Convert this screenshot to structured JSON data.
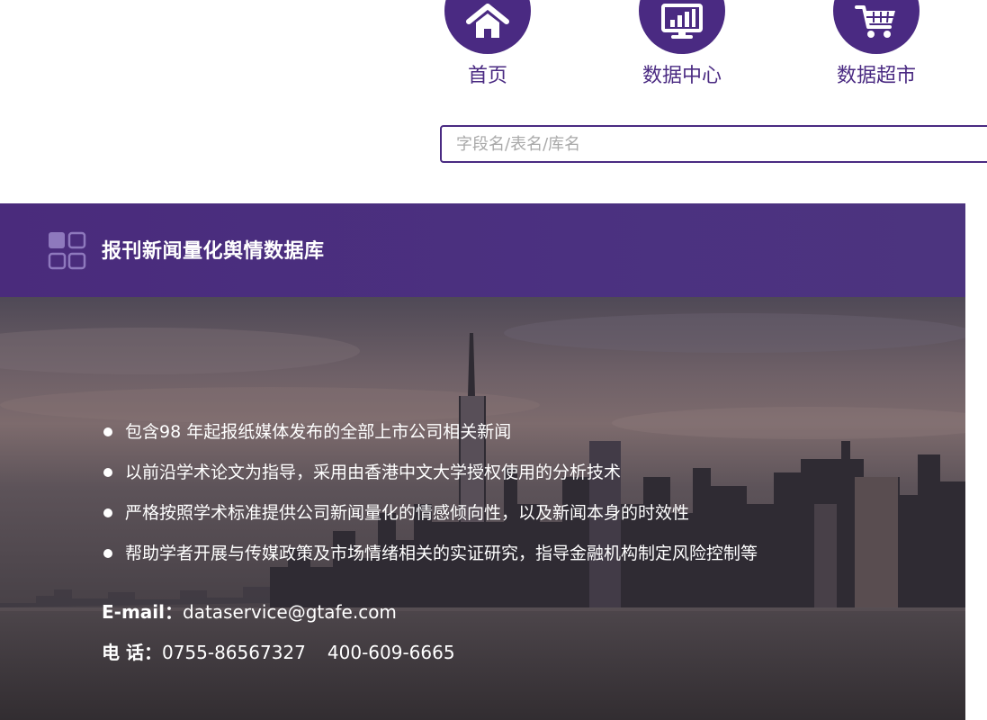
{
  "nav": {
    "items": [
      {
        "label": "首页",
        "icon": "home-icon"
      },
      {
        "label": "数据中心",
        "icon": "monitor-chart-icon"
      },
      {
        "label": "数据超市",
        "icon": "shopping-cart-icon"
      }
    ],
    "accent_color": "#4a2a82"
  },
  "search": {
    "placeholder": "字段名/表名/库名",
    "value": ""
  },
  "panel": {
    "icon": "grid-icon",
    "title": "报刊新闻量化舆情数据库",
    "features": [
      "包含98 年起报纸媒体发布的全部上市公司相关新闻",
      "以前沿学术论文为指导，采用由香港中文大学授权使用的分析技术",
      "严格按照学术标准提供公司新闻量化的情感倾向性，以及新闻本身的时效性",
      "帮助学者开展与传媒政策及市场情绪相关的实证研究，指导金融机构制定风险控制等"
    ],
    "email_label": "E-mail：",
    "email": "dataservice@gtafe.com",
    "phone_label": "电 话：",
    "phone_1": "0755-86567327",
    "phone_2": "400-609-6665"
  }
}
